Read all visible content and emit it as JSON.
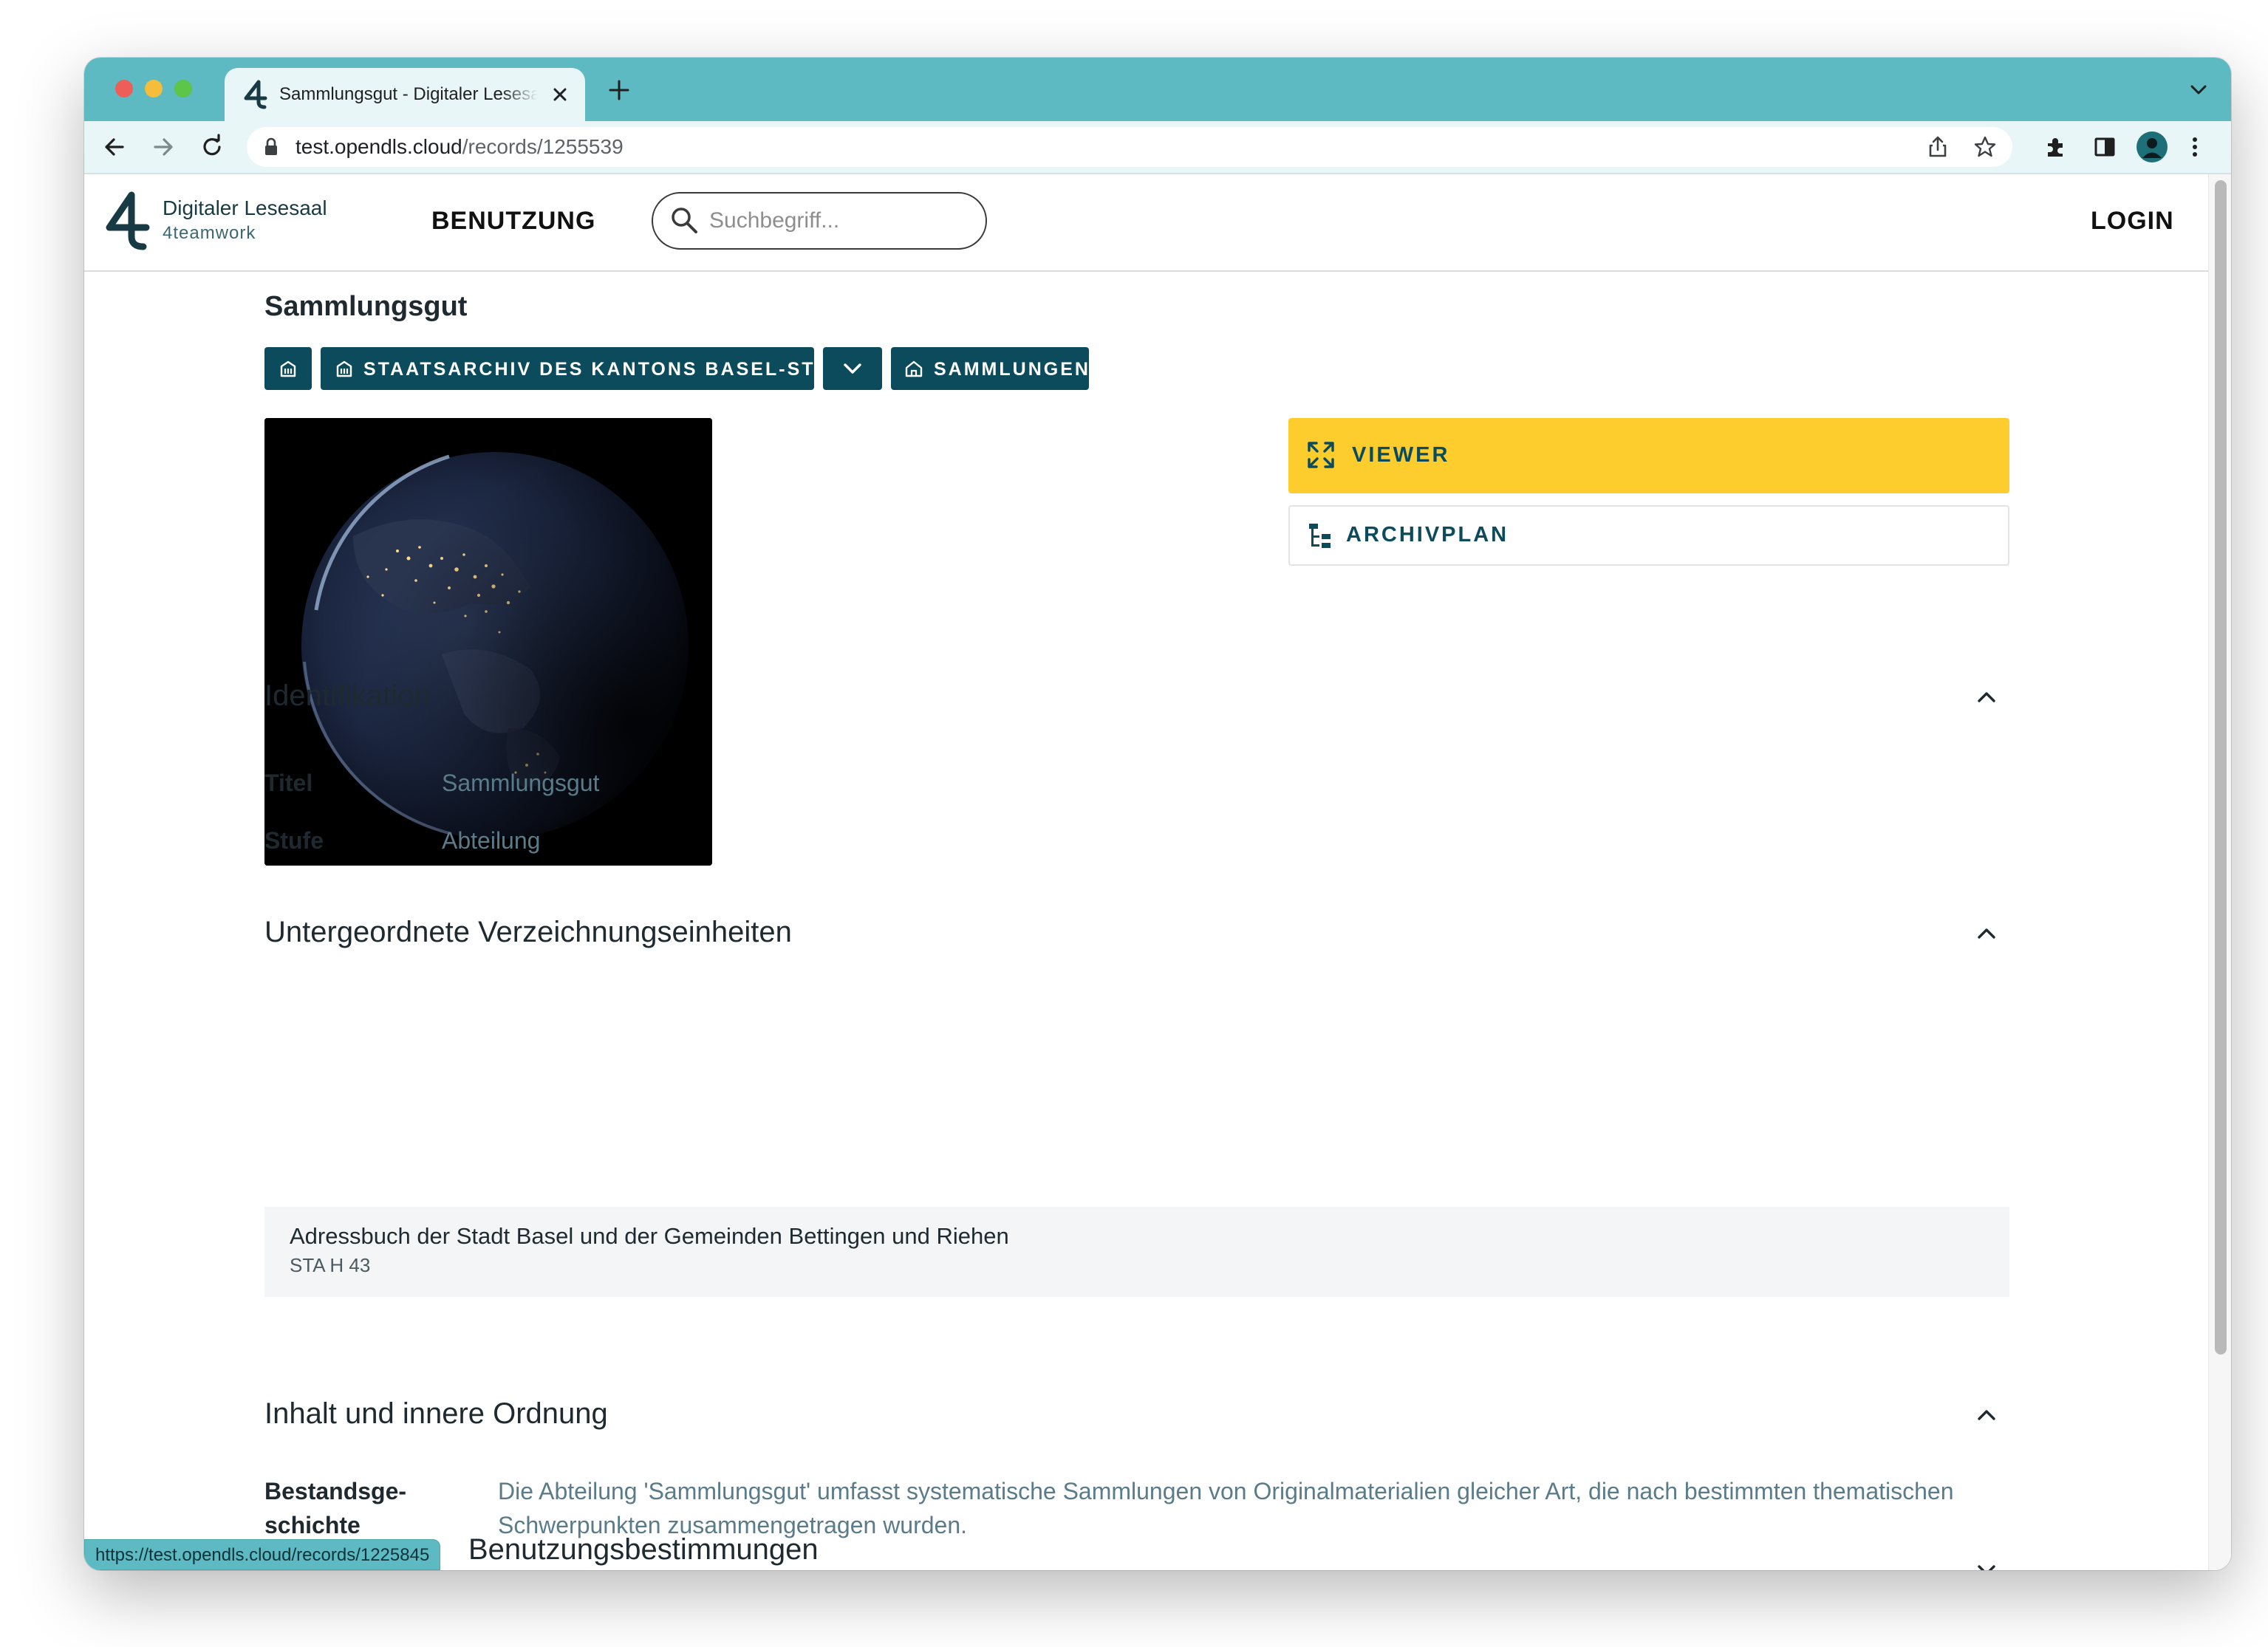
{
  "browser": {
    "tab_title": "Sammlungsgut - Digitaler Lesesaal",
    "url_host": "test.opendls.cloud",
    "url_path": "/records/1255539",
    "status_url": "https://test.opendls.cloud/records/1225845"
  },
  "site": {
    "brand_title": "Digitaler Lesesaal",
    "brand_subtitle": "4teamwork",
    "nav_label": "BENUTZUNG",
    "search_placeholder": "Suchbegriff...",
    "login_label": "LOGIN"
  },
  "record": {
    "title": "Sammlungsgut",
    "breadcrumbs": [
      {
        "label": "",
        "icon": "archive-building-icon"
      },
      {
        "label": "STAATSARCHIV DES KANTONS BASEL-STADT",
        "icon": "archive-building-icon"
      },
      {
        "label": "",
        "icon": "chevron-down-icon"
      },
      {
        "label": "SAMMLUNGEN",
        "icon": "home-icon"
      }
    ],
    "viewer_label": "VIEWER",
    "archivplan_label": "ARCHIVPLAN"
  },
  "sections": {
    "identifikation": {
      "heading": "Identifikation",
      "fields": [
        {
          "label": "Titel",
          "value": "Sammlungsgut"
        },
        {
          "label": "Stufe",
          "value": "Abteilung"
        }
      ]
    },
    "untergeordnete": {
      "heading": "Untergeordnete Verzeichnungseinheiten",
      "items": [
        {
          "title": "Adressbuch der Stadt Basel und der Gemeinden Bettingen und Riehen",
          "code": "STA H 43"
        }
      ]
    },
    "inhalt": {
      "heading": "Inhalt und innere Ordnung",
      "label_line1": "Bestandsge-",
      "label_line2": "schichte",
      "text": "Die Abteilung 'Sammlungsgut' umfasst systematische Sammlungen von Originalmaterialien gleicher Art, die nach bestimmten thematischen Schwerpunkten zusammengetragen wurden."
    },
    "benutzung": {
      "heading": "Benutzungsbestimmungen"
    }
  },
  "colors": {
    "chrome": "#5db9c2",
    "primary": "#0c4b5b",
    "viewer": "#fdcc2d"
  }
}
